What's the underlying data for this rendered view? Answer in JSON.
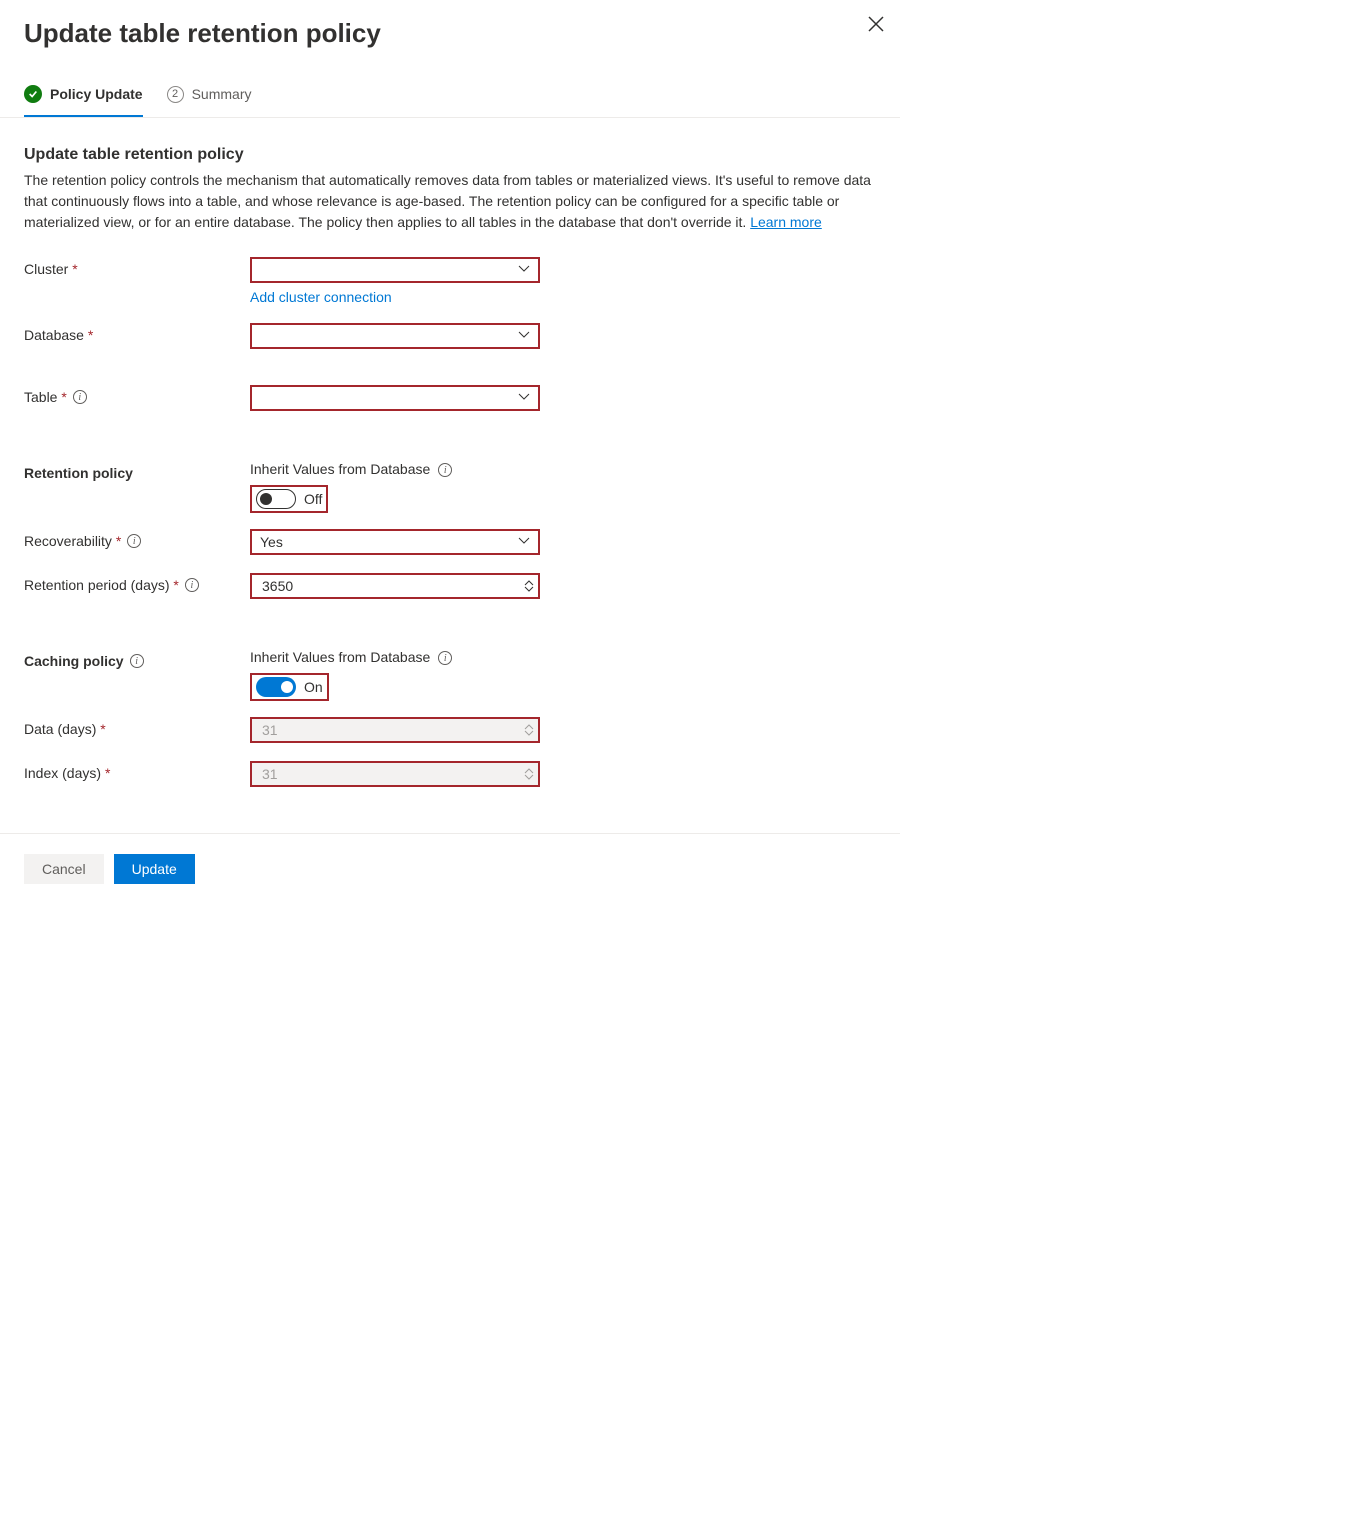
{
  "header": {
    "title": "Update table retention policy"
  },
  "tabs": {
    "step1": "Policy Update",
    "step2_num": "2",
    "step2": "Summary"
  },
  "intro": {
    "heading": "Update table retention policy",
    "text": "The retention policy controls the mechanism that automatically removes data from tables or materialized views. It's useful to remove data that continuously flows into a table, and whose relevance is age-based. The retention policy can be configured for a specific table or materialized view, or for an entire database. The policy then applies to all tables in the database that don't override it. ",
    "learn": "Learn more"
  },
  "fields": {
    "cluster": {
      "label": "Cluster",
      "add_link": "Add cluster connection"
    },
    "database": {
      "label": "Database"
    },
    "table": {
      "label": "Table"
    }
  },
  "retention": {
    "heading": "Retention policy",
    "inherit_label": "Inherit Values from Database",
    "toggle_state": "Off",
    "recoverability": {
      "label": "Recoverability",
      "value": "Yes"
    },
    "period": {
      "label": "Retention period (days)",
      "value": "3650"
    }
  },
  "caching": {
    "heading": "Caching policy",
    "inherit_label": "Inherit Values from Database",
    "toggle_state": "On",
    "data": {
      "label": "Data (days)",
      "value": "31"
    },
    "index": {
      "label": "Index (days)",
      "value": "31"
    }
  },
  "footer": {
    "cancel": "Cancel",
    "update": "Update"
  }
}
